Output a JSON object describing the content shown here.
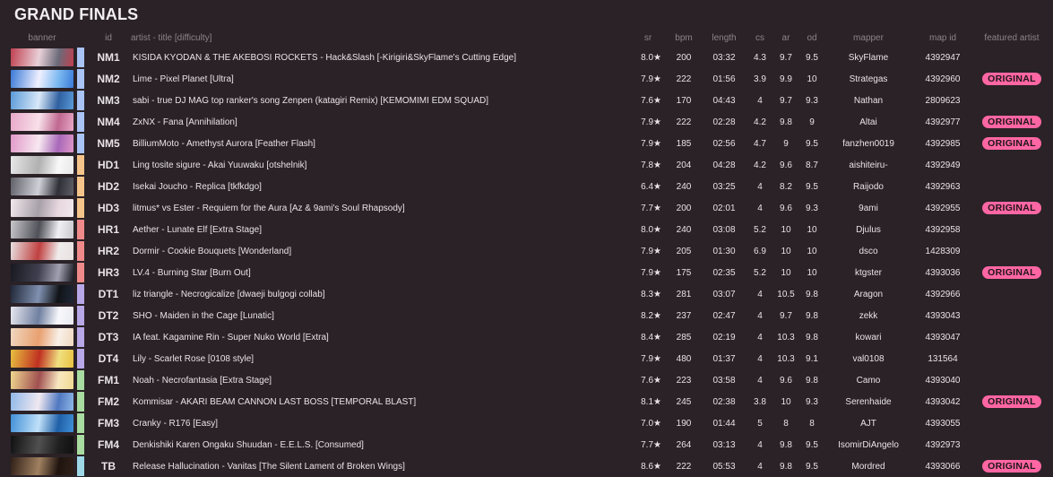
{
  "page_title": "GRAND FINALS",
  "columns": {
    "banner": "banner",
    "id": "id",
    "artist_title": "artist - title [difficulty]",
    "sr": "sr",
    "bpm": "bpm",
    "length": "length",
    "cs": "cs",
    "ar": "ar",
    "od": "od",
    "mapper": "mapper",
    "map_id": "map id",
    "featured_artist": "featured artist"
  },
  "featured_badge_label": "ORIGINAL",
  "star_glyph": "★",
  "mod_colors": {
    "NM": "#a9c4f5",
    "HD": "#f5c48a",
    "HR": "#f08a8a",
    "DT": "#b9a8e8",
    "FM": "#a8dca0",
    "TB": "#9fd9e8"
  },
  "rows": [
    {
      "id": "NM1",
      "mod": "NM",
      "title": "KISIDA KYODAN & THE AKEBOSI ROCKETS - Hack&Slash [-Kirigiri&SkyFlame's Cutting Edge]",
      "sr": "8.0",
      "bpm": "200",
      "length": "03:32",
      "cs": "4.3",
      "ar": "9.7",
      "od": "9.5",
      "mapper": "SkyFlame",
      "map_id": "4392947",
      "featured": false,
      "banner_colors": [
        "#c04050",
        "#e8d0d8",
        "#6a6a78"
      ]
    },
    {
      "id": "NM2",
      "mod": "NM",
      "title": "Lime - Pixel Planet [Ultra]",
      "sr": "7.9",
      "bpm": "222",
      "length": "01:56",
      "cs": "3.9",
      "ar": "9.9",
      "od": "10",
      "mapper": "Strategas",
      "map_id": "4392960",
      "featured": true,
      "banner_colors": [
        "#3a7ad8",
        "#f0f0ff",
        "#7ab8f0"
      ]
    },
    {
      "id": "NM3",
      "mod": "NM",
      "title": "sabi - true DJ MAG top ranker's song Zenpen (katagiri Remix) [KEMOMIMI EDM SQUAD]",
      "sr": "7.6",
      "bpm": "170",
      "length": "04:43",
      "cs": "4",
      "ar": "9.7",
      "od": "9.3",
      "mapper": "Nathan",
      "map_id": "2809623",
      "featured": false,
      "banner_colors": [
        "#5a9ad8",
        "#d8e8f8",
        "#3060a0"
      ]
    },
    {
      "id": "NM4",
      "mod": "NM",
      "title": "ZxNX - Fana [Annihilation]",
      "sr": "7.9",
      "bpm": "222",
      "length": "02:28",
      "cs": "4.2",
      "ar": "9.8",
      "od": "9",
      "mapper": "Altai",
      "map_id": "4392977",
      "featured": true,
      "banner_colors": [
        "#e8a8c8",
        "#f8e0ea",
        "#c06890"
      ]
    },
    {
      "id": "NM5",
      "mod": "NM",
      "title": "BilliumMoto - Amethyst Aurora [Feather Flash]",
      "sr": "7.9",
      "bpm": "185",
      "length": "02:56",
      "cs": "4.7",
      "ar": "9",
      "od": "9.5",
      "mapper": "fanzhen0019",
      "map_id": "4392985",
      "featured": true,
      "banner_colors": [
        "#e098c8",
        "#f8e8f0",
        "#a868b8"
      ]
    },
    {
      "id": "HD1",
      "mod": "HD",
      "title": "Ling tosite sigure - Akai Yuuwaku [otshelnik]",
      "sr": "7.8",
      "bpm": "204",
      "length": "04:28",
      "cs": "4.2",
      "ar": "9.6",
      "od": "8.7",
      "mapper": "aishiteiru-",
      "map_id": "4392949",
      "featured": false,
      "banner_colors": [
        "#e8e8e8",
        "#b0b0b0",
        "#f8f8f8"
      ]
    },
    {
      "id": "HD2",
      "mod": "HD",
      "title": "Isekai Joucho - Replica [tkfkdgo]",
      "sr": "6.4",
      "bpm": "240",
      "length": "03:25",
      "cs": "4",
      "ar": "8.2",
      "od": "9.5",
      "mapper": "Raijodo",
      "map_id": "4392963",
      "featured": false,
      "banner_colors": [
        "#606068",
        "#d0d0d8",
        "#303038"
      ]
    },
    {
      "id": "HD3",
      "mod": "HD",
      "title": "litmus* vs Ester - Requiem for the Aura [Az & 9ami's Soul Rhapsody]",
      "sr": "7.7",
      "bpm": "200",
      "length": "02:01",
      "cs": "4",
      "ar": "9.6",
      "od": "9.3",
      "mapper": "9ami",
      "map_id": "4392955",
      "featured": true,
      "banner_colors": [
        "#f0e8ec",
        "#a8a0a8",
        "#e8d8e0"
      ]
    },
    {
      "id": "HR1",
      "mod": "HR",
      "title": "Aether - Lunate Elf [Extra Stage]",
      "sr": "8.0",
      "bpm": "240",
      "length": "03:08",
      "cs": "5.2",
      "ar": "10",
      "od": "10",
      "mapper": "Djulus",
      "map_id": "4392958",
      "featured": false,
      "banner_colors": [
        "#c8c8cc",
        "#505058",
        "#f0f0f4"
      ]
    },
    {
      "id": "HR2",
      "mod": "HR",
      "title": "Dormir - Cookie Bouquets [Wonderland]",
      "sr": "7.9",
      "bpm": "205",
      "length": "01:30",
      "cs": "6.9",
      "ar": "10",
      "od": "10",
      "mapper": "dsco",
      "map_id": "1428309",
      "featured": false,
      "banner_colors": [
        "#e8e0e0",
        "#c04040",
        "#f0ecec"
      ]
    },
    {
      "id": "HR3",
      "mod": "HR",
      "title": "LV.4 - Burning Star [Burn Out]",
      "sr": "7.9",
      "bpm": "175",
      "length": "02:35",
      "cs": "5.2",
      "ar": "10",
      "od": "10",
      "mapper": "ktgster",
      "map_id": "4393036",
      "featured": true,
      "banner_colors": [
        "#181820",
        "#404050",
        "#a0a0b0"
      ]
    },
    {
      "id": "DT1",
      "mod": "DT",
      "title": "liz triangle - Necrogicalize [dwaeji bulgogi collab]",
      "sr": "8.3",
      "bpm": "281",
      "length": "03:07",
      "cs": "4",
      "ar": "10.5",
      "od": "9.8",
      "mapper": "Aragon",
      "map_id": "4392966",
      "featured": false,
      "banner_colors": [
        "#202838",
        "#8090b0",
        "#101418"
      ]
    },
    {
      "id": "DT2",
      "mod": "DT",
      "title": "SHO - Maiden in the Cage [Lunatic]",
      "sr": "8.2",
      "bpm": "237",
      "length": "02:47",
      "cs": "4",
      "ar": "9.7",
      "od": "9.8",
      "mapper": "zekk",
      "map_id": "4393043",
      "featured": false,
      "banner_colors": [
        "#e8e8f0",
        "#7080a0",
        "#f8f8fc"
      ]
    },
    {
      "id": "DT3",
      "mod": "DT",
      "title": "IA feat. Kagamine Rin - Super Nuko World [Extra]",
      "sr": "8.4",
      "bpm": "285",
      "length": "02:19",
      "cs": "4",
      "ar": "10.3",
      "od": "9.8",
      "mapper": "kowari",
      "map_id": "4393047",
      "featured": false,
      "banner_colors": [
        "#f0d8c0",
        "#e8a070",
        "#f8f0e8"
      ]
    },
    {
      "id": "DT4",
      "mod": "DT",
      "title": "Lily - Scarlet Rose [0108 style]",
      "sr": "7.9",
      "bpm": "480",
      "length": "01:37",
      "cs": "4",
      "ar": "10.3",
      "od": "9.1",
      "mapper": "val0108",
      "map_id": "131564",
      "featured": false,
      "banner_colors": [
        "#e8c040",
        "#c03020",
        "#f0e080"
      ]
    },
    {
      "id": "FM1",
      "mod": "FM",
      "title": "Noah - Necrofantasia [Extra Stage]",
      "sr": "7.6",
      "bpm": "223",
      "length": "03:58",
      "cs": "4",
      "ar": "9.6",
      "od": "9.8",
      "mapper": "Camo",
      "map_id": "4393040",
      "featured": false,
      "banner_colors": [
        "#f0d890",
        "#a05050",
        "#f8e8c0"
      ]
    },
    {
      "id": "FM2",
      "mod": "FM",
      "title": "Kommisar - AKARI BEAM CANNON LAST BOSS [TEMPORAL BLAST]",
      "sr": "8.1",
      "bpm": "245",
      "length": "02:38",
      "cs": "3.8",
      "ar": "10",
      "od": "9.3",
      "mapper": "Serenhaide",
      "map_id": "4393042",
      "featured": true,
      "banner_colors": [
        "#90b8e8",
        "#f0e8f0",
        "#5078c0"
      ]
    },
    {
      "id": "FM3",
      "mod": "FM",
      "title": "Cranky - R176 [Easy]",
      "sr": "7.0",
      "bpm": "190",
      "length": "01:44",
      "cs": "5",
      "ar": "8",
      "od": "8",
      "mapper": "AJT",
      "map_id": "4393055",
      "featured": false,
      "banner_colors": [
        "#4090d8",
        "#c0e0f8",
        "#2060a8"
      ]
    },
    {
      "id": "FM4",
      "mod": "FM",
      "title": "Denkishiki Karen Ongaku Shuudan - E.E.L.S. [Consumed]",
      "sr": "7.7",
      "bpm": "264",
      "length": "03:13",
      "cs": "4",
      "ar": "9.8",
      "od": "9.5",
      "mapper": "IsomirDiAngelo",
      "map_id": "4392973",
      "featured": false,
      "banner_colors": [
        "#101010",
        "#505050",
        "#202020"
      ]
    },
    {
      "id": "TB",
      "mod": "TB",
      "title": "Release Hallucination - Vanitas [The Silent Lament of Broken Wings]",
      "sr": "8.6",
      "bpm": "222",
      "length": "05:53",
      "cs": "4",
      "ar": "9.8",
      "od": "9.5",
      "mapper": "Mordred",
      "map_id": "4393066",
      "featured": true,
      "banner_colors": [
        "#302018",
        "#a08060",
        "#201410"
      ]
    }
  ]
}
